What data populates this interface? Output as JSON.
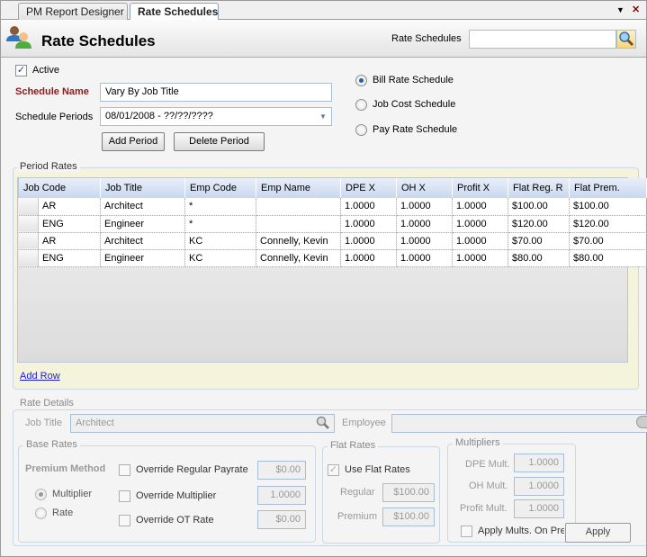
{
  "tabs": [
    {
      "label": "PM Report Designer",
      "active": false
    },
    {
      "label": "Rate Schedules",
      "active": true
    }
  ],
  "tab_controls": {
    "dropdown": "▼",
    "close": "✕"
  },
  "header": {
    "title": "Rate Schedules",
    "search_label": "Rate Schedules",
    "search_value": "",
    "icon": "users-icon"
  },
  "form": {
    "active_label": "Active",
    "active_checked": true,
    "schedule_name_label": "Schedule Name",
    "schedule_name_value": "Vary By Job Title",
    "schedule_periods_label": "Schedule Periods",
    "schedule_periods_value": "08/01/2008 - ??/??/????",
    "add_period_label": "Add Period",
    "delete_period_label": "Delete Period",
    "schedule_types": [
      {
        "label": "Bill Rate Schedule",
        "checked": true
      },
      {
        "label": "Job Cost Schedule",
        "checked": false
      },
      {
        "label": "Pay Rate Schedule",
        "checked": false
      }
    ]
  },
  "period_rates": {
    "title": "Period Rates",
    "columns": [
      "Job Code",
      "Job Title",
      "Emp Code",
      "Emp Name",
      "DPE X",
      "OH X",
      "Profit X",
      "Flat Reg. R",
      "Flat Prem."
    ],
    "rows": [
      [
        "AR",
        "Architect",
        "*",
        "",
        "1.0000",
        "1.0000",
        "1.0000",
        "$100.00",
        "$100.00"
      ],
      [
        "ENG",
        "Engineer",
        "*",
        "",
        "1.0000",
        "1.0000",
        "1.0000",
        "$120.00",
        "$120.00"
      ],
      [
        "AR",
        "Architect",
        "KC",
        "Connelly, Kevin",
        "1.0000",
        "1.0000",
        "1.0000",
        "$70.00",
        "$70.00"
      ],
      [
        "ENG",
        "Engineer",
        "KC",
        "Connelly, Kevin",
        "1.0000",
        "1.0000",
        "1.0000",
        "$80.00",
        "$80.00"
      ]
    ],
    "add_row_label": "Add Row"
  },
  "rate_details": {
    "title": "Rate Details",
    "job_title_label": "Job Title",
    "job_title_value": "Architect",
    "employee_label": "Employee",
    "employee_value": "",
    "base_rates": {
      "title": "Base Rates",
      "premium_method_label": "Premium Method",
      "methods": [
        {
          "label": "Multiplier",
          "checked": true
        },
        {
          "label": "Rate",
          "checked": false
        }
      ],
      "overrides": [
        {
          "label": "Override Regular Payrate",
          "checked": false,
          "value": "$0.00"
        },
        {
          "label": "Override Multiplier",
          "checked": false,
          "value": "1.0000"
        },
        {
          "label": "Override OT Rate",
          "checked": false,
          "value": "$0.00"
        }
      ]
    },
    "flat_rates": {
      "title": "Flat Rates",
      "use_flat_rates_label": "Use Flat Rates",
      "use_flat_rates_checked": true,
      "regular_label": "Regular",
      "regular_value": "$100.00",
      "premium_label": "Premium",
      "premium_value": "$100.00"
    },
    "multipliers": {
      "title": "Multipliers",
      "dpe_label": "DPE Mult.",
      "dpe_value": "1.0000",
      "oh_label": "OH Mult.",
      "oh_value": "1.0000",
      "profit_label": "Profit Mult.",
      "profit_value": "1.0000",
      "apply_on_premium_label": "Apply Mults. On Pre",
      "apply_on_premium_checked": false
    },
    "apply_label": "Apply"
  }
}
